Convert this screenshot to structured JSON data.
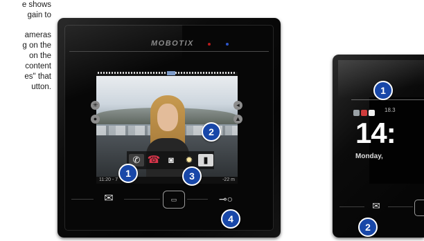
{
  "manual_text": {
    "line1": "e shows",
    "line2": "gain to",
    "line3": "ameras",
    "line4": "g on the",
    "line5": "on the",
    "line6": "content",
    "line7": "es\" that",
    "line8": "utton."
  },
  "device": {
    "brand": "MOBOTIX",
    "screen": {
      "time_label": "11:20 - 7",
      "distance_label": "-22 m",
      "icons": {
        "accept": "phone-icon",
        "hangup": "hangup-icon",
        "camera": "camera-icon",
        "light": "light-icon",
        "door": "door-icon"
      }
    },
    "badges": [
      "1",
      "2",
      "3",
      "4"
    ],
    "hardware_buttons": [
      "letter-icon",
      "home-button",
      "key-icon"
    ]
  },
  "device2": {
    "status_time": "18.3",
    "clock": "14:",
    "date": "Monday,",
    "badges": [
      "1",
      "2"
    ]
  },
  "colors": {
    "badge_blue": "#1847a8",
    "led_red": "#b81b1b",
    "led_blue": "#2d55c9",
    "hangup_red": "#d8354a"
  }
}
